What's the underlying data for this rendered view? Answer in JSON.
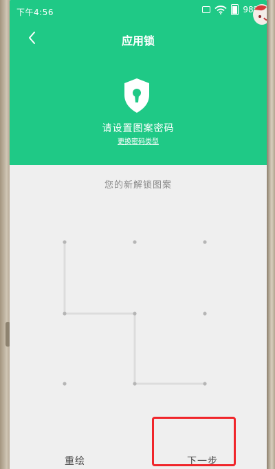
{
  "status_bar": {
    "time": "下午4:56",
    "battery": "98%"
  },
  "header": {
    "title": "应用锁",
    "subtitle": "请设置图案密码",
    "change_type_link": "更换密码类型"
  },
  "pattern": {
    "prompt": "您的新解锁图案",
    "path": [
      0,
      3,
      4,
      7,
      8
    ]
  },
  "buttons": {
    "redraw": "重绘",
    "next": "下一步"
  },
  "colors": {
    "accent": "#1fc986",
    "highlight": "#f0252a"
  },
  "icons": {
    "back": "back-arrow-icon",
    "shield": "shield-lock-icon",
    "wifi": "wifi-icon",
    "sim": "sim-card-icon",
    "battery": "battery-icon"
  }
}
